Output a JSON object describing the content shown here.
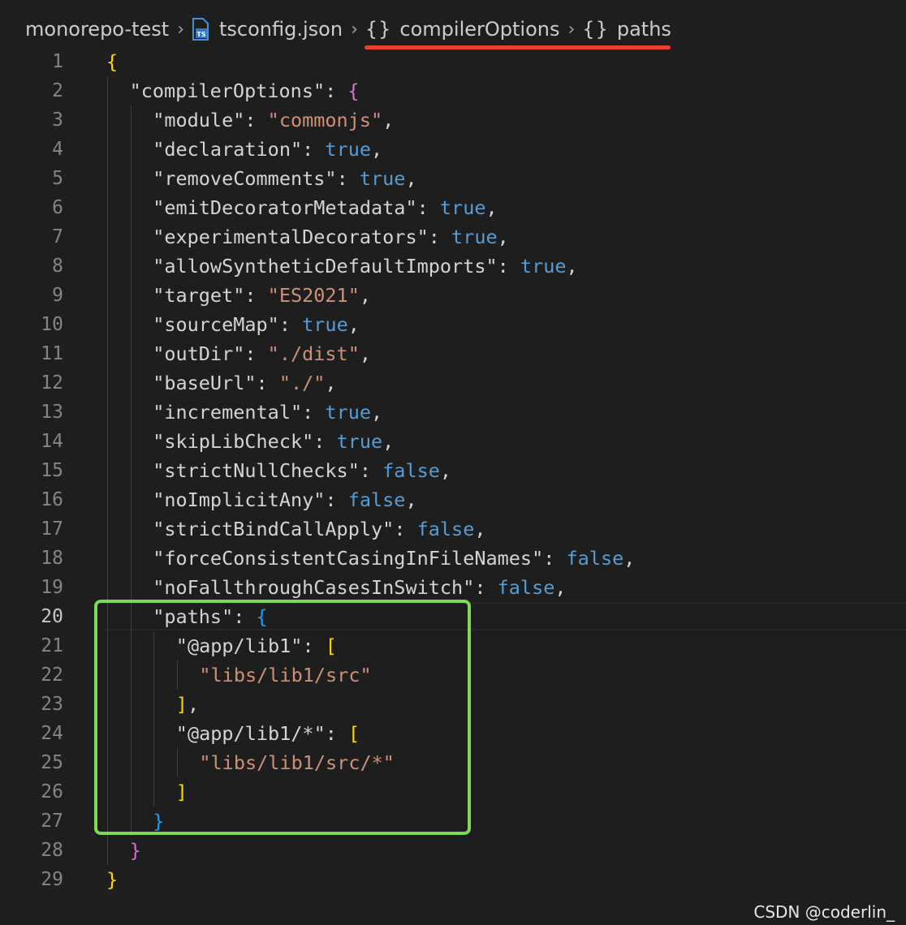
{
  "breadcrumb": {
    "items": [
      {
        "label": "monorepo-test",
        "icon": null
      },
      {
        "label": "tsconfig.json",
        "icon": "typescript-config-file-icon"
      },
      {
        "label": "compilerOptions",
        "icon": "braces-icon"
      },
      {
        "label": "paths",
        "icon": "braces-icon"
      }
    ],
    "separator": ">",
    "file_badge": "TS",
    "braces_glyph": "{}"
  },
  "editor": {
    "active_line": 20,
    "lines": [
      {
        "n": "1",
        "indent": 0,
        "tokens": [
          [
            "b-gold",
            "{"
          ]
        ]
      },
      {
        "n": "2",
        "indent": 1,
        "tokens": [
          [
            "key",
            "\"compilerOptions\""
          ],
          [
            "punct",
            ": "
          ],
          [
            "b-pink",
            "{"
          ]
        ]
      },
      {
        "n": "3",
        "indent": 2,
        "tokens": [
          [
            "key",
            "\"module\""
          ],
          [
            "punct",
            ": "
          ],
          [
            "str",
            "\"commonjs\""
          ],
          [
            "punct",
            ","
          ]
        ]
      },
      {
        "n": "4",
        "indent": 2,
        "tokens": [
          [
            "key",
            "\"declaration\""
          ],
          [
            "punct",
            ": "
          ],
          [
            "bool",
            "true"
          ],
          [
            "punct",
            ","
          ]
        ]
      },
      {
        "n": "5",
        "indent": 2,
        "tokens": [
          [
            "key",
            "\"removeComments\""
          ],
          [
            "punct",
            ": "
          ],
          [
            "bool",
            "true"
          ],
          [
            "punct",
            ","
          ]
        ]
      },
      {
        "n": "6",
        "indent": 2,
        "tokens": [
          [
            "key",
            "\"emitDecoratorMetadata\""
          ],
          [
            "punct",
            ": "
          ],
          [
            "bool",
            "true"
          ],
          [
            "punct",
            ","
          ]
        ]
      },
      {
        "n": "7",
        "indent": 2,
        "tokens": [
          [
            "key",
            "\"experimentalDecorators\""
          ],
          [
            "punct",
            ": "
          ],
          [
            "bool",
            "true"
          ],
          [
            "punct",
            ","
          ]
        ]
      },
      {
        "n": "8",
        "indent": 2,
        "tokens": [
          [
            "key",
            "\"allowSyntheticDefaultImports\""
          ],
          [
            "punct",
            ": "
          ],
          [
            "bool",
            "true"
          ],
          [
            "punct",
            ","
          ]
        ]
      },
      {
        "n": "9",
        "indent": 2,
        "tokens": [
          [
            "key",
            "\"target\""
          ],
          [
            "punct",
            ": "
          ],
          [
            "str",
            "\"ES2021\""
          ],
          [
            "punct",
            ","
          ]
        ]
      },
      {
        "n": "10",
        "indent": 2,
        "tokens": [
          [
            "key",
            "\"sourceMap\""
          ],
          [
            "punct",
            ": "
          ],
          [
            "bool",
            "true"
          ],
          [
            "punct",
            ","
          ]
        ]
      },
      {
        "n": "11",
        "indent": 2,
        "tokens": [
          [
            "key",
            "\"outDir\""
          ],
          [
            "punct",
            ": "
          ],
          [
            "str",
            "\"./dist\""
          ],
          [
            "punct",
            ","
          ]
        ]
      },
      {
        "n": "12",
        "indent": 2,
        "tokens": [
          [
            "key",
            "\"baseUrl\""
          ],
          [
            "punct",
            ": "
          ],
          [
            "str",
            "\"./\""
          ],
          [
            "punct",
            ","
          ]
        ]
      },
      {
        "n": "13",
        "indent": 2,
        "tokens": [
          [
            "key",
            "\"incremental\""
          ],
          [
            "punct",
            ": "
          ],
          [
            "bool",
            "true"
          ],
          [
            "punct",
            ","
          ]
        ]
      },
      {
        "n": "14",
        "indent": 2,
        "tokens": [
          [
            "key",
            "\"skipLibCheck\""
          ],
          [
            "punct",
            ": "
          ],
          [
            "bool",
            "true"
          ],
          [
            "punct",
            ","
          ]
        ]
      },
      {
        "n": "15",
        "indent": 2,
        "tokens": [
          [
            "key",
            "\"strictNullChecks\""
          ],
          [
            "punct",
            ": "
          ],
          [
            "bool",
            "false"
          ],
          [
            "punct",
            ","
          ]
        ]
      },
      {
        "n": "16",
        "indent": 2,
        "tokens": [
          [
            "key",
            "\"noImplicitAny\""
          ],
          [
            "punct",
            ": "
          ],
          [
            "bool",
            "false"
          ],
          [
            "punct",
            ","
          ]
        ]
      },
      {
        "n": "17",
        "indent": 2,
        "tokens": [
          [
            "key",
            "\"strictBindCallApply\""
          ],
          [
            "punct",
            ": "
          ],
          [
            "bool",
            "false"
          ],
          [
            "punct",
            ","
          ]
        ]
      },
      {
        "n": "18",
        "indent": 2,
        "tokens": [
          [
            "key",
            "\"forceConsistentCasingInFileNames\""
          ],
          [
            "punct",
            ": "
          ],
          [
            "bool",
            "false"
          ],
          [
            "punct",
            ","
          ]
        ]
      },
      {
        "n": "19",
        "indent": 2,
        "tokens": [
          [
            "key",
            "\"noFallthroughCasesInSwitch\""
          ],
          [
            "punct",
            ": "
          ],
          [
            "bool",
            "false"
          ],
          [
            "punct",
            ","
          ]
        ]
      },
      {
        "n": "20",
        "indent": 2,
        "tokens": [
          [
            "key",
            "\"paths\""
          ],
          [
            "punct",
            ": "
          ],
          [
            "b-blue",
            "{"
          ]
        ]
      },
      {
        "n": "21",
        "indent": 3,
        "tokens": [
          [
            "key",
            "\"@app/lib1\""
          ],
          [
            "punct",
            ": "
          ],
          [
            "b-gold",
            "["
          ]
        ]
      },
      {
        "n": "22",
        "indent": 4,
        "tokens": [
          [
            "str",
            "\"libs/lib1/src\""
          ]
        ]
      },
      {
        "n": "23",
        "indent": 3,
        "tokens": [
          [
            "b-gold",
            "]"
          ],
          [
            "punct",
            ","
          ]
        ]
      },
      {
        "n": "24",
        "indent": 3,
        "tokens": [
          [
            "key",
            "\"@app/lib1/*\""
          ],
          [
            "punct",
            ": "
          ],
          [
            "b-gold",
            "["
          ]
        ]
      },
      {
        "n": "25",
        "indent": 4,
        "tokens": [
          [
            "str",
            "\"libs/lib1/src/*\""
          ]
        ]
      },
      {
        "n": "26",
        "indent": 3,
        "tokens": [
          [
            "b-gold",
            "]"
          ]
        ]
      },
      {
        "n": "27",
        "indent": 2,
        "tokens": [
          [
            "b-blue",
            "}"
          ]
        ]
      },
      {
        "n": "28",
        "indent": 1,
        "tokens": [
          [
            "b-pink",
            "}"
          ]
        ]
      },
      {
        "n": "29",
        "indent": 0,
        "tokens": [
          [
            "b-gold",
            "}"
          ]
        ]
      }
    ]
  },
  "annotations": {
    "underline_color": "#e8412c",
    "highlight_box_color": "#7ed957"
  },
  "watermark": "CSDN @coderlin_"
}
